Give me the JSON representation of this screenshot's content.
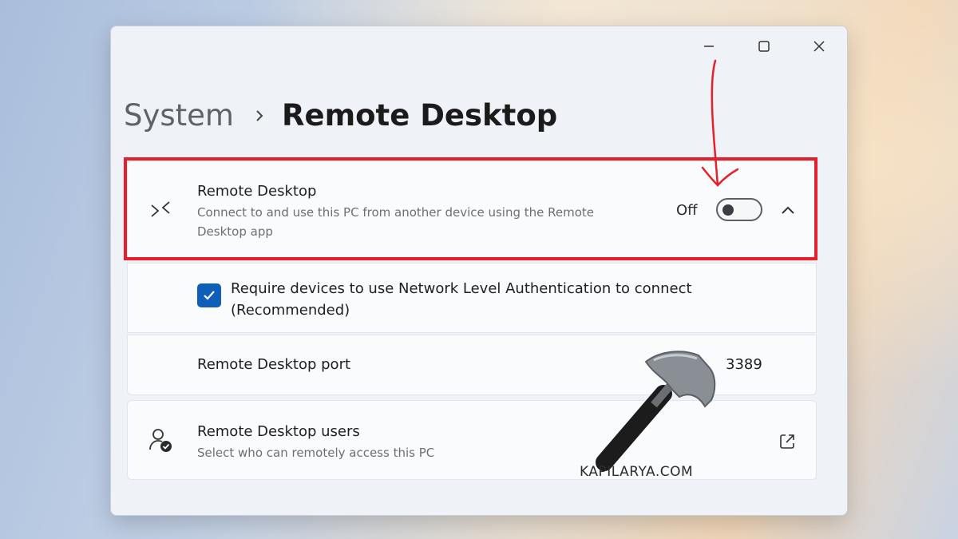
{
  "breadcrumb": {
    "parent": "System",
    "current": "Remote Desktop"
  },
  "remote_desktop": {
    "title": "Remote Desktop",
    "description_line1": "Connect to and use this PC from another device using the Remote",
    "description_line2": "Desktop app",
    "toggle_label": "Off",
    "toggle_on": false
  },
  "nla": {
    "label_line1": "Require devices to use Network Level Authentication to connect",
    "label_line2": "(Recommended)",
    "checked": true
  },
  "port": {
    "label": "Remote Desktop port",
    "value": "3389"
  },
  "users": {
    "title": "Remote Desktop users",
    "description": "Select who can remotely access this PC"
  },
  "watermark": {
    "text": "KAPILARYA.COM"
  },
  "colors": {
    "highlight": "#e5202c",
    "checkbox": "#0f5eb8",
    "hammer_head": "#8a8f96",
    "hammer_handle": "#1c1c1c"
  },
  "icons": {
    "remote_desktop": "remote-desktop-icon",
    "users": "user-check-icon",
    "external_link": "open-external-icon",
    "chevron": "chevron-up-icon"
  }
}
